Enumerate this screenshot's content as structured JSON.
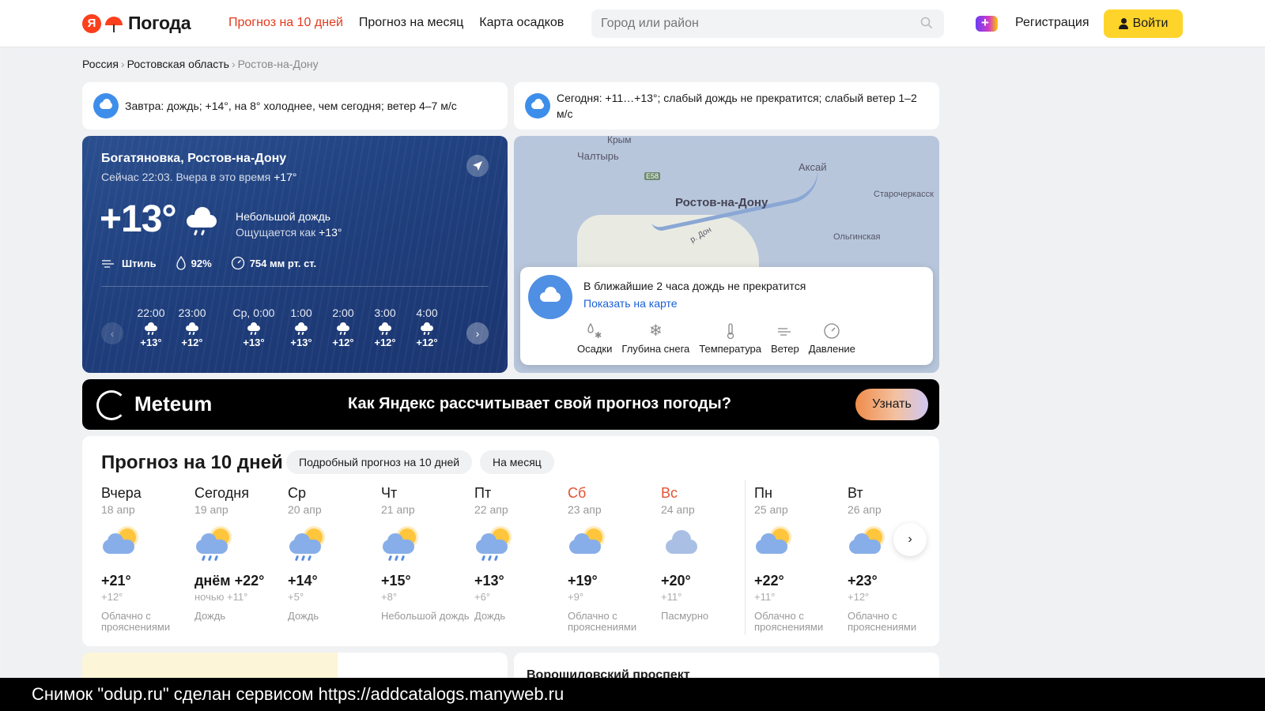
{
  "header": {
    "logo_ya": "Я",
    "logo_text": "Погода",
    "nav": [
      "Прогноз на 10 дней",
      "Прогноз на месяц",
      "Карта осадков"
    ],
    "search_placeholder": "Город или район",
    "register": "Регистрация",
    "login": "Войти"
  },
  "breadcrumb": [
    "Россия",
    "Ростовская область",
    "Ростов-на-Дону"
  ],
  "alerts": {
    "tomorrow": "Завтра: дождь; +14°, на 8° холоднее, чем сегодня; ветер 4–7 м/с",
    "today": "Сегодня: +11…+13°; слабый дождь не прекратится; слабый ветер 1–2 м/с"
  },
  "now": {
    "place": "Богатяновка, Ростов-на-Дону",
    "time_text": "Сейчас 22:03. Вчера в это время",
    "yesterday_temp": "+17°",
    "temp": "+13°",
    "condition": "Небольшой дождь",
    "feels_label": "Ощущается как",
    "feels_value": "+13°",
    "wind": "Штиль",
    "humidity": "92%",
    "pressure": "754 мм рт. ст.",
    "hours": [
      {
        "time": "22:00",
        "temp": "+13°"
      },
      {
        "time": "23:00",
        "temp": "+12°"
      },
      {
        "time": "Ср, 0:00",
        "temp": "+13°"
      },
      {
        "time": "1:00",
        "temp": "+13°"
      },
      {
        "time": "2:00",
        "temp": "+12°"
      },
      {
        "time": "3:00",
        "temp": "+12°"
      },
      {
        "time": "4:00",
        "temp": "+12°"
      }
    ]
  },
  "map": {
    "labels": [
      "Крым",
      "Чалтырь",
      "Аксай",
      "Старочеркасск",
      "Ольгинская",
      "р. Дон",
      "Е58"
    ],
    "city": "Ростов-на-Дону",
    "popup_text": "В ближайшие 2 часа дождь не прекратится",
    "popup_link": "Показать на карте",
    "layers": [
      "Осадки",
      "Глубина снега",
      "Температура",
      "Ветер",
      "Давление"
    ]
  },
  "banner": {
    "brand": "Meteum",
    "question": "Как Яндекс рассчитывает свой прогноз погоды?",
    "button": "Узнать"
  },
  "forecast": {
    "title": "Прогноз на 10 дней",
    "pill_detailed": "Подробный прогноз на 10 дней",
    "pill_month": "На месяц",
    "days": [
      {
        "name": "Вчера",
        "date": "18 апр",
        "high": "+21°",
        "low": "+12°",
        "cond": "Облачно с прояснениями",
        "icon": "partly-cloudy",
        "weekend": false
      },
      {
        "name": "Сегодня",
        "date": "19 апр",
        "high": "днём +22°",
        "low": "ночью +11°",
        "cond": "Дождь",
        "icon": "rain-sun",
        "weekend": false
      },
      {
        "name": "Ср",
        "date": "20 апр",
        "high": "+14°",
        "low": "+5°",
        "cond": "Дождь",
        "icon": "rain-sun",
        "weekend": false
      },
      {
        "name": "Чт",
        "date": "21 апр",
        "high": "+15°",
        "low": "+8°",
        "cond": "Небольшой дождь",
        "icon": "rain-sun",
        "weekend": false
      },
      {
        "name": "Пт",
        "date": "22 апр",
        "high": "+13°",
        "low": "+6°",
        "cond": "Дождь",
        "icon": "rain-sun",
        "weekend": false
      },
      {
        "name": "Сб",
        "date": "23 апр",
        "high": "+19°",
        "low": "+9°",
        "cond": "Облачно с прояснениями",
        "icon": "partly-cloudy",
        "weekend": true
      },
      {
        "name": "Вс",
        "date": "24 апр",
        "high": "+20°",
        "low": "+11°",
        "cond": "Пасмурно",
        "icon": "overcast",
        "weekend": true
      },
      {
        "name": "Пн",
        "date": "25 апр",
        "high": "+22°",
        "low": "+11°",
        "cond": "Облачно с прояснениями",
        "icon": "partly-cloudy",
        "weekend": false
      },
      {
        "name": "Вт",
        "date": "26 апр",
        "high": "+23°",
        "low": "+12°",
        "cond": "Облачно с прояснениями",
        "icon": "partly-cloudy",
        "weekend": false
      }
    ]
  },
  "bottom": {
    "street": "Ворошиловский проспект"
  },
  "footer": "Снимок \"odup.ru\" сделан сервисом https://addcatalogs.manyweb.ru",
  "colors": {
    "accent": "#e4391b",
    "login_bg": "#fed42b",
    "link": "#1a5fd6",
    "weekend": "#e45232"
  }
}
